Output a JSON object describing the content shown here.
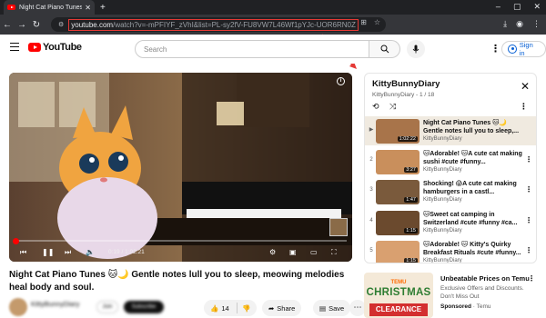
{
  "browser": {
    "tab_title": "Night Cat Piano Tunes 🐱 🔊",
    "tab_close": "✕",
    "new_tab": "+",
    "url_host": "youtube.com",
    "url_rest": "/watch?v=-mPFIYF_zVhI&list=PL-sy2fV-FU8VW7L46Wf1pYJc-UOR6RN0Z"
  },
  "header": {
    "logo_text": "YouTube",
    "search_placeholder": "Search",
    "signin_label": "Sign in"
  },
  "player": {
    "time": "0:19 / 1:02:21",
    "progress_fraction": 0.005
  },
  "video": {
    "title": "Night Cat Piano Tunes 🐱🌙 Gentle notes lull you to sleep, meowing melodies heal body and soul.",
    "channel_name": "KittyBunnyDiary",
    "join_label": "Join",
    "subscribe_label": "Subscribe",
    "like_count": "14",
    "share_label": "Share",
    "save_label": "Save"
  },
  "playlist": {
    "title": "KittyBunnyDiary",
    "subtitle": "KittyBunnyDiary - 1 / 18",
    "items": [
      {
        "index": "▶",
        "title": "Night Cat Piano Tunes 🐱🌙 Gentle notes lull you to sleep,...",
        "channel": "KittyBunnyDiary",
        "duration": "1:02:22",
        "thumb_color": "#a8744a"
      },
      {
        "index": "2",
        "title": "🐱Adorable! 🐱A cute cat making sushi #cute #funny...",
        "channel": "KittyBunnyDiary",
        "duration": "3:27",
        "thumb_color": "#c98f5c"
      },
      {
        "index": "3",
        "title": "Shocking! 😱A cute cat making hamburgers in a castl...",
        "channel": "KittyBunnyDiary",
        "duration": "1:47",
        "thumb_color": "#7a5a3c"
      },
      {
        "index": "4",
        "title": "🐱Sweet cat camping in Switzerland #cute #funny #ca...",
        "channel": "KittyBunnyDiary",
        "duration": "1:15",
        "thumb_color": "#6b4a2e"
      },
      {
        "index": "5",
        "title": "🐱Adorable! 🐱 Kitty's Quirky Breakfast Rituals #cute #funny...",
        "channel": "KittyBunnyDiary",
        "duration": "1:15",
        "thumb_color": "#d9a070"
      }
    ]
  },
  "ad": {
    "brand_small": "TEMU",
    "headline": "CHRISTMAS",
    "banner": "CLEARANCE",
    "title": "Unbeatable Prices on Temu",
    "description": "Exclusive Offers and Discounts. Don't Miss Out",
    "sponsored_label": "Sponsored",
    "sponsor": "· Temu"
  },
  "colors": {
    "brand_red": "#ff0000",
    "link_blue": "#065fd4",
    "annotation_red": "#e53935"
  }
}
